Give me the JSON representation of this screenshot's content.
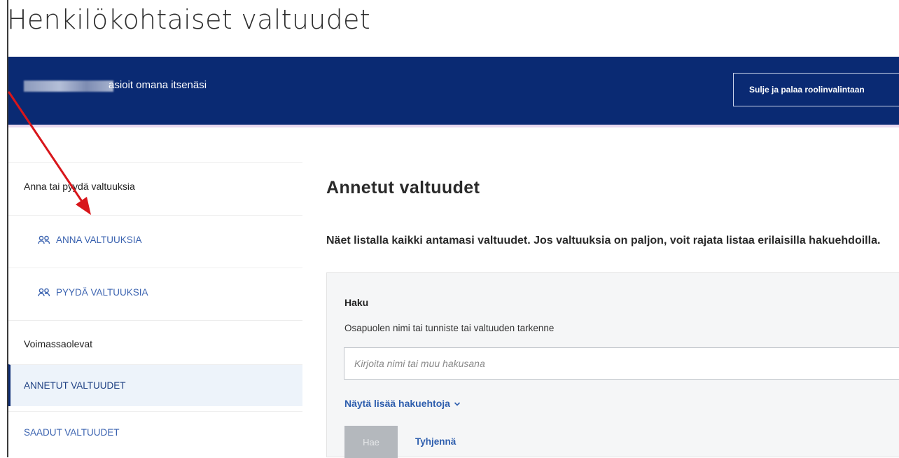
{
  "page": {
    "title": "Henkilökohtaiset valtuudet"
  },
  "role_bar": {
    "role_text": "asioit omana itsenäsi",
    "back_button_label": "Sulje ja palaa roolinvalintaan",
    "background_color": "#0a2a73"
  },
  "sidebar": {
    "give_request_heading": "Anna tai pyydä valtuuksia",
    "actions": [
      {
        "label": "ANNA VALTUUKSIA",
        "icon": "people-icon"
      },
      {
        "label": "PYYDÄ VALTUUKSIA",
        "icon": "people-icon"
      }
    ],
    "valid_heading": "Voimassaolevat",
    "links": [
      {
        "label": "ANNETUT VALTUUDET",
        "active": true
      },
      {
        "label": "SAADUT VALTUUDET",
        "active": false
      }
    ]
  },
  "main": {
    "title": "Annetut valtuudet",
    "intro": "Näet listalla kaikki antamasi valtuudet. Jos valtuuksia on paljon, voit rajata listaa erilaisilla hakuehdoilla.",
    "search": {
      "heading": "Haku",
      "label": "Osapuolen nimi tai tunniste tai valtuuden tarkenne",
      "value": "",
      "placeholder": "Kirjoita nimi tai muu hakusana",
      "more_options": "Näytä lisää hakuehtoja",
      "search_button": "Hae",
      "clear_button": "Tyhjennä"
    }
  },
  "annotation": {
    "arrow_color": "#d8161b"
  },
  "colors": {
    "link": "#3b63b0",
    "active_bg": "#edf3fa",
    "panel_bg": "#f5f6f7"
  }
}
